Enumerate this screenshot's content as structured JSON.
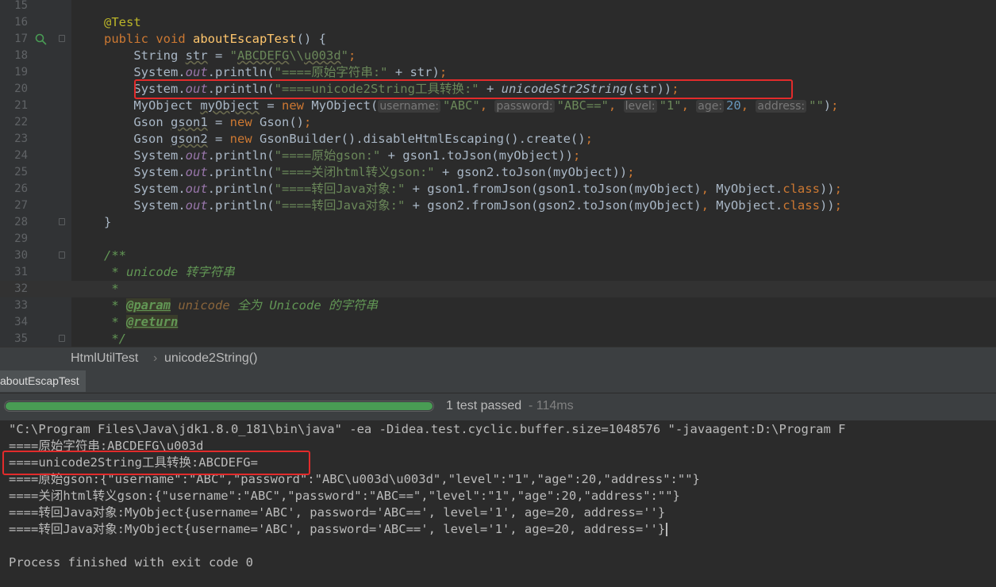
{
  "editor": {
    "lines": [
      {
        "n": "15",
        "html": ""
      },
      {
        "n": "16",
        "html": "<span class='ann'>@Test</span>"
      },
      {
        "n": "17",
        "html": "<span class='kw'>public void </span><span class='fn'>aboutEscapTest</span>() {"
      },
      {
        "n": "18",
        "html": "    String <span class='und'>str</span> = <span class='str'>\"<span class='und'>ABCDEFG</span>\\\\<span class='und'>u003d</span>\"</span><span class='kw'>;</span>"
      },
      {
        "n": "19",
        "html": "    System.<span class='st'>out</span>.println(<span class='str'>\"====原始字符串:\"</span> + str)<span class='kw'>;</span>"
      },
      {
        "n": "20",
        "html": "    System.<span class='st'>out</span>.println(<span class='str'>\"====unicode2String工具转换:\"</span> + <span class='it'>unicodeStr2String</span>(str))<span class='kw'>;</span>"
      },
      {
        "n": "21",
        "html": "    MyObject <span class='und'>myObject</span> = <span class='kw'>new </span>MyObject(<span class='hint'>username:</span><span class='str'>\"ABC\"</span><span class='kw'>, </span><span class='hint'>password:</span><span class='str'>\"ABC==\"</span><span class='kw'>, </span><span class='hint'>level:</span><span class='str'>\"1\"</span><span class='kw'>, </span><span class='hint'>age:</span><span class='num'>20</span><span class='kw'>, </span><span class='hint'>address:</span><span class='str'>\"\"</span>)<span class='kw'>;</span>"
      },
      {
        "n": "22",
        "html": "    Gson <span class='und'>gson1</span> = <span class='kw'>new </span>Gson()<span class='kw'>;</span>"
      },
      {
        "n": "23",
        "html": "    Gson <span class='und'>gson2</span> = <span class='kw'>new </span>GsonBuilder().disableHtmlEscaping().create()<span class='kw'>;</span>"
      },
      {
        "n": "24",
        "html": "    System.<span class='st'>out</span>.println(<span class='str'>\"====原始gson:\"</span> + gson1.toJson(myObject))<span class='kw'>;</span>"
      },
      {
        "n": "25",
        "html": "    System.<span class='st'>out</span>.println(<span class='str'>\"====关闭html转义gson:\"</span> + gson2.toJson(myObject))<span class='kw'>;</span>"
      },
      {
        "n": "26",
        "html": "    System.<span class='st'>out</span>.println(<span class='str'>\"====转回Java对象:\"</span> + gson1.fromJson(gson1.toJson(myObject)<span class='kw'>, </span>MyObject.<span class='kw'>class</span>))<span class='kw'>;</span>"
      },
      {
        "n": "27",
        "html": "    System.<span class='st'>out</span>.println(<span class='str'>\"====转回Java对象:\"</span> + gson2.fromJson(gson2.toJson(myObject)<span class='kw'>, </span>MyObject.<span class='kw'>class</span>))<span class='kw'>;</span>"
      },
      {
        "n": "28",
        "html": "}"
      },
      {
        "n": "29",
        "html": ""
      },
      {
        "n": "30",
        "html": "<span class='doc'>/**</span>"
      },
      {
        "n": "31",
        "html": "<span class='doc'> * unicode 转字符串</span>"
      },
      {
        "n": "32",
        "html": "<span class='doc'> *</span>"
      },
      {
        "n": "33",
        "html": "<span class='doc'> * </span><span class='doctag'>@param</span><span class='doc'> <span style=\"color:#8a653b\">unicode</span> 全为 Unicode 的字符串</span>"
      },
      {
        "n": "34",
        "html": "<span class='doc'> * </span><span class='doctag'>@return</span>"
      },
      {
        "n": "35",
        "html": "<span class='doc'> */</span>"
      }
    ]
  },
  "breadcrumb": {
    "class_name": "HtmlUtilTest",
    "separator": "›",
    "method_name": "unicode2String()"
  },
  "run_tab": {
    "label": "aboutEscapTest"
  },
  "status": {
    "progress": 1.0,
    "passed_text": "1 test passed",
    "duration_text": "- 114ms",
    "progress_color": "#499c54"
  },
  "console": {
    "lines": [
      "\"C:\\Program Files\\Java\\jdk1.8.0_181\\bin\\java\" -ea -Didea.test.cyclic.buffer.size=1048576 \"-javaagent:D:\\Program F",
      "====原始字符串:ABCDEFG\\u003d",
      "====unicode2String工具转换:ABCDEFG=",
      "====原始gson:{\"username\":\"ABC\",\"password\":\"ABC\\u003d\\u003d\",\"level\":\"1\",\"age\":20,\"address\":\"\"}",
      "====关闭html转义gson:{\"username\":\"ABC\",\"password\":\"ABC==\",\"level\":\"1\",\"age\":20,\"address\":\"\"}",
      "====转回Java对象:MyObject{username='ABC', password='ABC==', level='1', age=20, address=''}",
      "====转回Java对象:MyObject{username='ABC', password='ABC==', level='1', age=20, address=''}",
      "",
      "Process finished with exit code 0"
    ]
  },
  "icons": {
    "run_gutter": "run-test-icon",
    "fold": "fold-marker-icon"
  }
}
